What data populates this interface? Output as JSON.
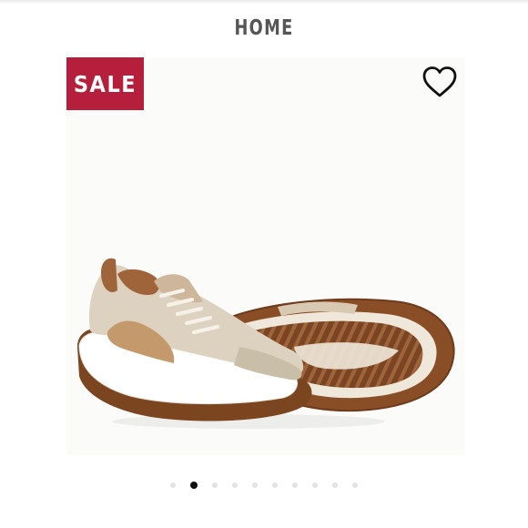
{
  "header": {
    "title": "HOME"
  },
  "product": {
    "badge": "SALE",
    "badge_color": "#b51f3c",
    "wishlist_icon": "heart-outline-icon",
    "image": "beige-suede-sneakers"
  },
  "carousel": {
    "count": 10,
    "active_index": 1
  }
}
